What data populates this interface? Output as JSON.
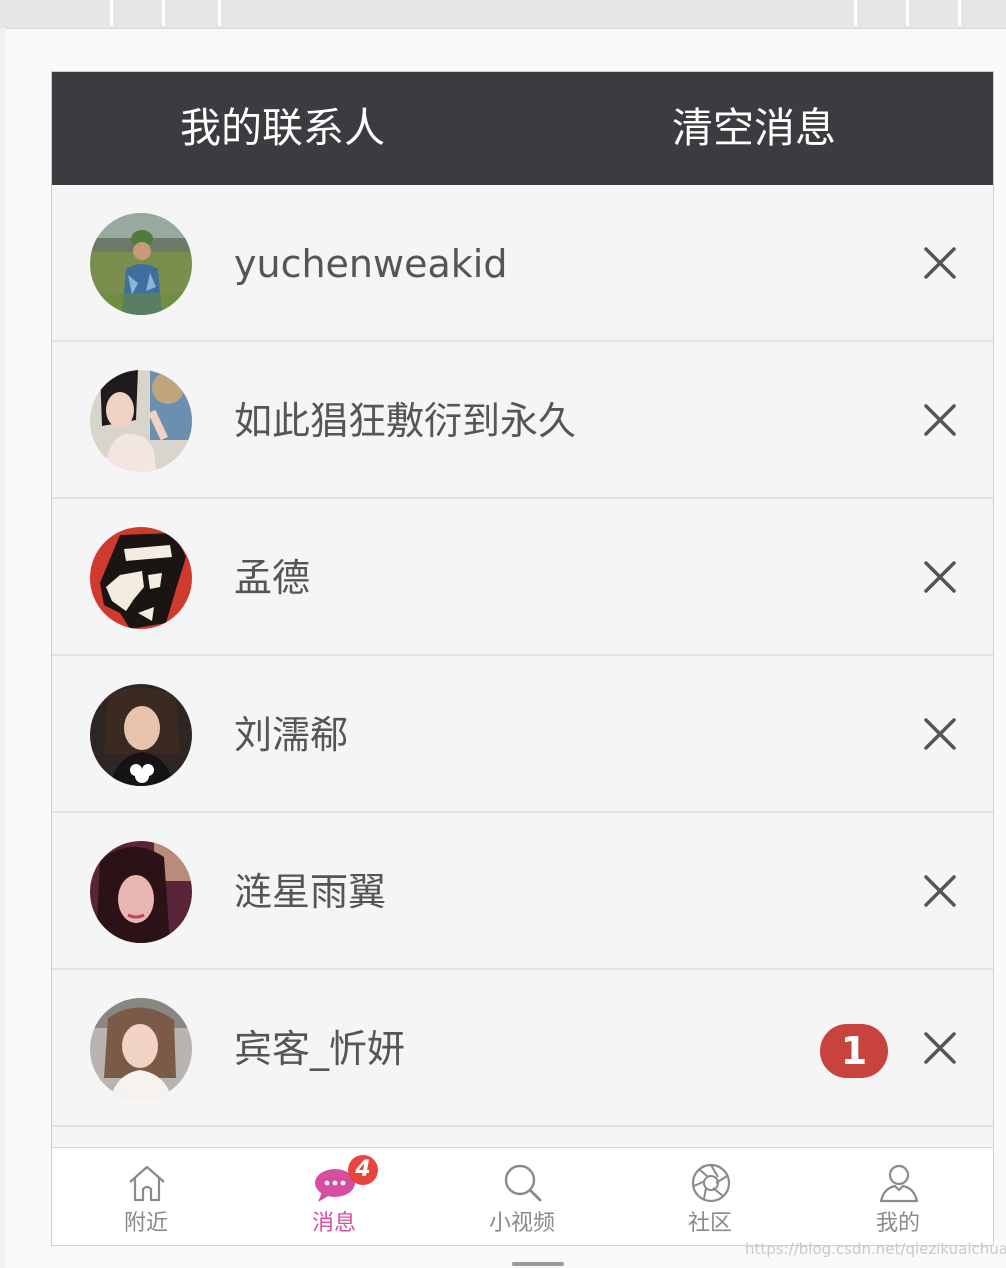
{
  "header": {
    "title": "我的联系人",
    "clear_label": "清空消息"
  },
  "contacts": [
    {
      "name": "yuchenweakid",
      "unread": null
    },
    {
      "name": "如此猖狂敷衍到永久",
      "unread": null
    },
    {
      "name": "孟德",
      "unread": null
    },
    {
      "name": "刘濡郗",
      "unread": null
    },
    {
      "name": "涟星雨翼",
      "unread": null
    },
    {
      "name": "宾客_忻妍",
      "unread": "1"
    }
  ],
  "tabs": [
    {
      "label": "附近",
      "icon": "home-icon",
      "active": false
    },
    {
      "label": "消息",
      "icon": "chat-icon",
      "active": true,
      "badge": "4"
    },
    {
      "label": "小视频",
      "icon": "search-icon",
      "active": false
    },
    {
      "label": "社区",
      "icon": "aperture-icon",
      "active": false
    },
    {
      "label": "我的",
      "icon": "user-icon",
      "active": false
    }
  ],
  "watermark": "https://blog.csdn.net/qiezikuaichuan",
  "colors": {
    "header_bg": "#3b3c40",
    "active_tab": "#d64ea0",
    "badge": "#c8423e"
  }
}
